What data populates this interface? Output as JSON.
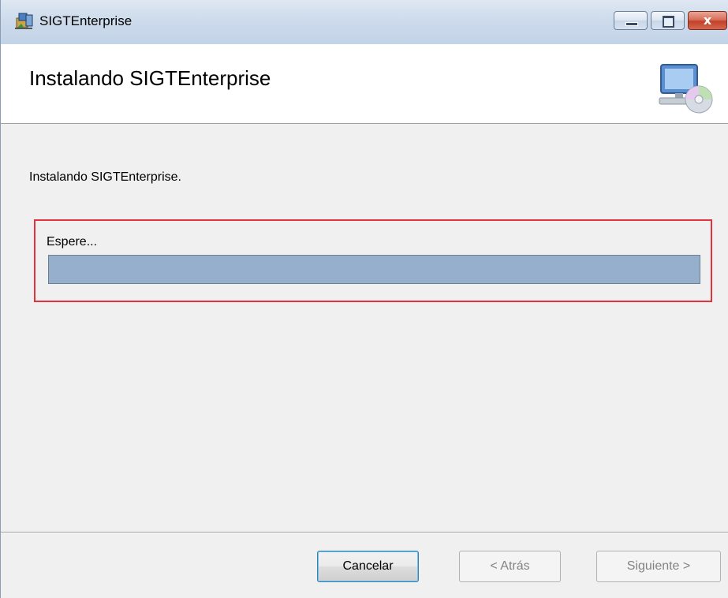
{
  "window": {
    "title": "SIGTEnterprise",
    "icons": {
      "app": "installer-package-icon",
      "minimize": "minimize-icon",
      "maximize": "maximize-icon",
      "close": "close-icon"
    },
    "close_glyph": "x"
  },
  "banner": {
    "title": "Instalando SIGTEnterprise",
    "icon": "computer-with-disc-icon"
  },
  "content": {
    "status": "Instalando SIGTEnterprise.",
    "progress": {
      "label": "Espere...",
      "value_percent": 100,
      "highlight_color": "#e2323c",
      "fill_color": "#96afcc"
    }
  },
  "footer": {
    "cancel_label": "Cancelar",
    "back_label": "< Atrás",
    "next_label": "Siguiente >"
  }
}
